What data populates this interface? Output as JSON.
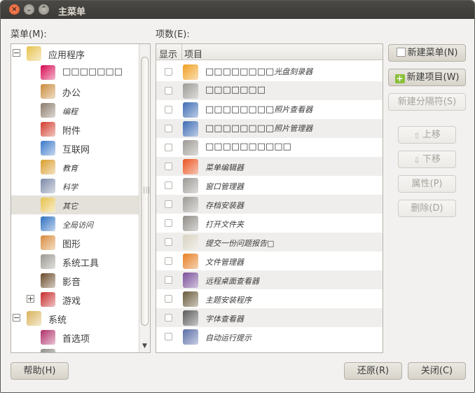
{
  "window": {
    "title": "主菜单",
    "close_glyph": "×",
    "min_glyph": "⌄",
    "max_glyph": "⌃"
  },
  "menus_label": "菜单(M):",
  "items_label": "项数(E):",
  "tree": [
    {
      "label": "应用程序",
      "expander": "−",
      "icon": "applications-icon",
      "icon_color": "#e7c14b",
      "level": 0,
      "small": false
    },
    {
      "label": "□□□□□□□",
      "icon": "debian-swirl-icon",
      "icon_color": "#d70751",
      "level": 1,
      "small": false
    },
    {
      "label": "办公",
      "icon": "office-icon",
      "icon_color": "#c98b3a",
      "level": 1,
      "small": false
    },
    {
      "label": "编程",
      "icon": "programming-trowel-icon",
      "icon_color": "#8a7b6a",
      "level": 1,
      "small": true
    },
    {
      "label": "附件",
      "icon": "accessories-knife-icon",
      "icon_color": "#d23c2d",
      "level": 1,
      "small": false
    },
    {
      "label": "互联网",
      "icon": "internet-globe-icon",
      "icon_color": "#3a78c9",
      "level": 1,
      "small": false
    },
    {
      "label": "教育",
      "icon": "education-icon",
      "icon_color": "#d99c2b",
      "level": 1,
      "small": true
    },
    {
      "label": "科学",
      "icon": "science-icon",
      "icon_color": "#7c8aa8",
      "level": 1,
      "small": true
    },
    {
      "label": "其它",
      "icon": "other-icon",
      "icon_color": "#e7c14b",
      "level": 1,
      "small": true,
      "selected": true
    },
    {
      "label": "全局访问",
      "icon": "universal-access-icon",
      "icon_color": "#2c6fc0",
      "level": 1,
      "small": true
    },
    {
      "label": "图形",
      "icon": "graphics-icon",
      "icon_color": "#d88a3b",
      "level": 1,
      "small": false
    },
    {
      "label": "系统工具",
      "icon": "system-tools-gear-icon",
      "icon_color": "#9a9890",
      "level": 1,
      "small": false
    },
    {
      "label": "影音",
      "icon": "multimedia-icon",
      "icon_color": "#6a4a2a",
      "level": 1,
      "small": false
    },
    {
      "label": "游戏",
      "expander": "+",
      "icon": "games-cards-icon",
      "icon_color": "#c72b2b",
      "level": 1,
      "small": false
    },
    {
      "label": "系统",
      "expander": "−",
      "icon": "system-icon",
      "icon_color": "#d9b35a",
      "level": 0,
      "small": false
    },
    {
      "label": "首选项",
      "icon": "preferences-icon",
      "icon_color": "#b0306a",
      "level": 1,
      "small": false
    },
    {
      "label": "",
      "icon": "administration-icon",
      "icon_color": "#8f8d86",
      "level": 1,
      "small": false
    }
  ],
  "items_header": {
    "show": "显示",
    "item": "项目"
  },
  "items": [
    {
      "text": "□□□□□□□□",
      "suffix": "光盘刻录器",
      "icon": "disc-burner-icon",
      "icon_color": "#f0a020"
    },
    {
      "text": "□□□□□□□",
      "suffix": "",
      "icon": "unknown-app-icon",
      "icon_color": "#9c9a94"
    },
    {
      "text": "□□□□□□□□",
      "suffix": "照片查看器",
      "icon": "photo-viewer-icon",
      "icon_color": "#3d6bb3"
    },
    {
      "text": "□□□□□□□□",
      "suffix": "照片管理器",
      "icon": "photo-manager-icon",
      "icon_color": "#3d6bb3"
    },
    {
      "text": "□□□□□□□□□□",
      "suffix": "",
      "icon": "unknown-app-icon",
      "icon_color": "#9c9a94"
    },
    {
      "text": "菜单编辑器",
      "suffix": "",
      "icon": "ubuntu-logo-icon",
      "icon_color": "#e95420",
      "small": true
    },
    {
      "text": "窗口管理器",
      "suffix": "",
      "icon": "unknown-app-icon",
      "icon_color": "#9c9a94",
      "small": true
    },
    {
      "text": "存档安装器",
      "suffix": "",
      "icon": "unknown-app-icon",
      "icon_color": "#9c9a94",
      "small": true
    },
    {
      "text": "打开文件夹",
      "suffix": "",
      "icon": "folder-icon",
      "icon_color": "#8f8c84",
      "small": true
    },
    {
      "text": "提交一份问题报告□",
      "suffix": "",
      "icon": "bug-report-icon",
      "icon_color": "#d8d2c0",
      "small": true
    },
    {
      "text": "文件管理器",
      "suffix": "",
      "icon": "file-manager-icon",
      "icon_color": "#e67e22",
      "small": true
    },
    {
      "text": "远程桌面查看器",
      "suffix": "",
      "icon": "remote-desktop-icon",
      "icon_color": "#7a4e9a",
      "small": true
    },
    {
      "text": "主题安装程序",
      "suffix": "",
      "icon": "theme-installer-icon",
      "icon_color": "#6a5a3a",
      "small": true
    },
    {
      "text": "字体查看器",
      "suffix": "",
      "icon": "font-viewer-icon",
      "icon_color": "#5a5a5a",
      "small": true
    },
    {
      "text": "自动运行提示",
      "suffix": "",
      "icon": "autorun-icon",
      "icon_color": "#5b6ea8",
      "small": true
    }
  ],
  "buttons": {
    "new_menu": "新建菜单(N)",
    "new_item": "新建项目(W)",
    "new_separator": "新建分隔符(S)",
    "move_up": "上移",
    "move_down": "下移",
    "properties": "属性(P)",
    "delete": "删除(D)",
    "help": "帮助(H)",
    "revert": "还原(R)",
    "close": "关闭(C)"
  },
  "colors": {
    "accent_orange": "#e95420",
    "titlebar": "#3c3b37",
    "selection": "#e4e1da"
  }
}
